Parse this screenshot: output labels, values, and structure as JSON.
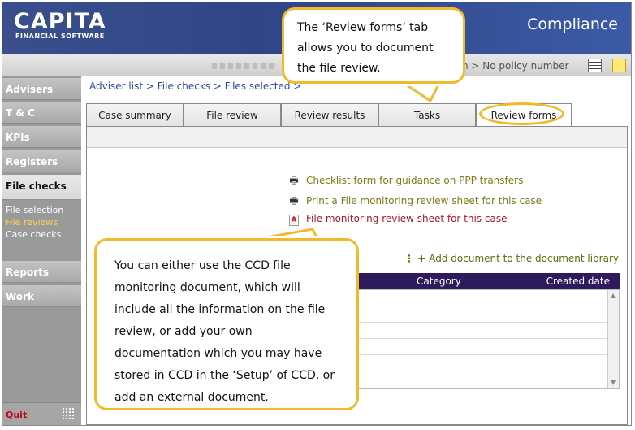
{
  "header": {
    "logo_main": "CAPITA",
    "logo_sub": "FINANCIAL SOFTWARE",
    "app_name": "Compliance"
  },
  "graybar": {
    "policy_text": "n > No policy number",
    "icons": [
      "table-icon",
      "note-icon"
    ]
  },
  "sidebar": {
    "items": [
      {
        "label": "Advisers"
      },
      {
        "label": "T & C"
      },
      {
        "label": "KPIs"
      },
      {
        "label": "Registers"
      },
      {
        "label": "File checks"
      },
      {
        "label": "Reports"
      },
      {
        "label": "Work"
      }
    ],
    "subitems": [
      {
        "label": "File selection"
      },
      {
        "label": "File reviews"
      },
      {
        "label": "Case checks"
      }
    ],
    "quit": "Quit"
  },
  "breadcrumb": "Adviser list > File checks > Files selected >",
  "tabs": [
    {
      "label": "Case summary"
    },
    {
      "label": "File review"
    },
    {
      "label": "Review results"
    },
    {
      "label": "Tasks"
    },
    {
      "label": "Review forms"
    }
  ],
  "links": [
    {
      "label": "Checklist form for guidance on PPP transfers",
      "icon": "printer-icon"
    },
    {
      "label": "Print a File monitoring review sheet for this case",
      "icon": "printer-icon"
    },
    {
      "label": "File monitoring review sheet for this case",
      "icon": "pdf-icon"
    }
  ],
  "add_document": "Add document to the document library",
  "grid": {
    "columns": [
      "Category",
      "Created date"
    ]
  },
  "callouts": {
    "top": "The ‘Review forms’ tab allows you to document the file review.",
    "bottom": "You can either use the CCD file monitoring document, which will include all the information on the file review, or add your own documentation which you may have stored in CCD in the ‘Setup’ of CCD, or add an external document."
  },
  "colors": {
    "header_blue": "#2f4586",
    "callout_border": "#f2b92b",
    "grid_header": "#2e1a5c",
    "active_subnav": "#ffd447",
    "quit": "#c8001a"
  }
}
